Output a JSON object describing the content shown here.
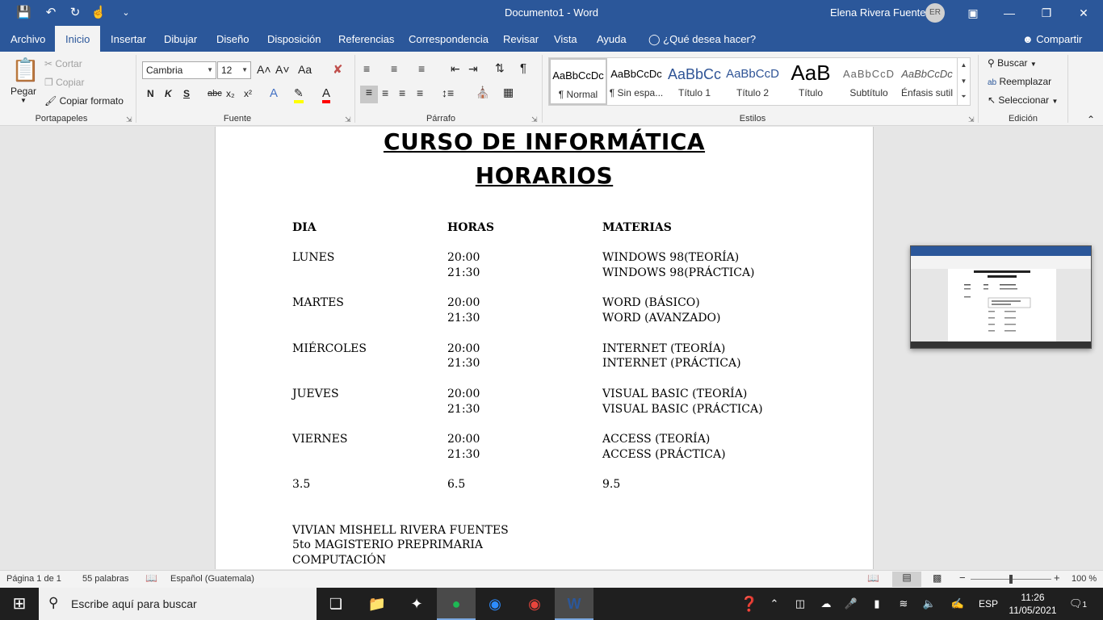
{
  "window": {
    "doc_title": "Documento1  -  Word",
    "user_name": "Elena Rivera Fuentes",
    "user_initials": "ER"
  },
  "qa": {
    "save": "💾",
    "undo": "↶",
    "redo": "↻",
    "touch": "☝",
    "customize": "⌄"
  },
  "tabs": [
    "Archivo",
    "Inicio",
    "Insertar",
    "Dibujar",
    "Diseño",
    "Disposición",
    "Referencias",
    "Correspondencia",
    "Revisar",
    "Vista",
    "Ayuda"
  ],
  "tell_me": "¿Qué desea hacer?",
  "share": "Compartir",
  "clipboard": {
    "paste": "Pegar",
    "cut": "Cortar",
    "copy": "Copiar",
    "format_painter": "Copiar formato",
    "group": "Portapapeles"
  },
  "font": {
    "name": "Cambria",
    "size": "12",
    "group": "Fuente",
    "bold": "N",
    "italic": "K",
    "underline": "S",
    "strike": "abc",
    "sub": "x₂",
    "sup": "x²",
    "grow": "A˄",
    "shrink": "A˅",
    "case": "Aa",
    "effects": "A",
    "color_letter": "A"
  },
  "paragraph": {
    "group": "Párrafo",
    "pilcrow": "¶"
  },
  "styles": {
    "group": "Estilos",
    "items": [
      {
        "preview": "AaBbCcDc",
        "name": "¶ Normal"
      },
      {
        "preview": "AaBbCcDc",
        "name": "¶ Sin espa..."
      },
      {
        "preview": "AaBbCc",
        "name": "Título 1"
      },
      {
        "preview": "AaBbCcD",
        "name": "Título 2"
      },
      {
        "preview": "AaB",
        "name": "Título"
      },
      {
        "preview": "AaBbCcD",
        "name": "Subtítulo"
      },
      {
        "preview": "AaBbCcDc",
        "name": "Énfasis sutil"
      }
    ]
  },
  "editing": {
    "find": "Buscar",
    "replace": "Reemplazar",
    "select": "Seleccionar",
    "group": "Edición"
  },
  "document": {
    "title1": "CURSO DE INFORMÁTICA",
    "title2": "HORARIOS",
    "headers": [
      "DIA",
      "HORAS",
      "MATERIAS"
    ],
    "rows": [
      {
        "day": "LUNES",
        "times": [
          "20:00",
          "21:30"
        ],
        "subjects": [
          "WINDOWS 98(TEORÍA)",
          "WINDOWS 98(PRÁCTICA)"
        ]
      },
      {
        "day": "MARTES",
        "times": [
          "20:00",
          "21:30"
        ],
        "subjects": [
          "WORD (BÁSICO)",
          "WORD (AVANZADO)"
        ]
      },
      {
        "day": "MIÉRCOLES",
        "times": [
          "20:00",
          "21:30"
        ],
        "subjects": [
          "INTERNET (TEORÍA)",
          "INTERNET (PRÁCTICA)"
        ]
      },
      {
        "day": "JUEVES",
        "times": [
          "20:00",
          "21:30"
        ],
        "subjects": [
          "VISUAL BASIC (TEORÍA)",
          "VISUAL BASIC (PRÁCTICA)"
        ]
      },
      {
        "day": "VIERNES",
        "times": [
          "20:00",
          "21:30"
        ],
        "subjects": [
          "ACCESS (TEORÍA)",
          "ACCESS (PRÁCTICA)"
        ]
      }
    ],
    "totals": [
      "3.5",
      "6.5",
      "9.5"
    ],
    "footer": [
      "VIVIAN MISHELL RIVERA FUENTES",
      "5to MAGISTERIO PREPRIMARIA",
      "COMPUTACIÓN"
    ]
  },
  "status": {
    "page": "Página 1 de 1",
    "words": "55 palabras",
    "language": "Español (Guatemala)",
    "zoom": "100 %",
    "zoom_value": 100
  },
  "taskbar": {
    "search_placeholder": "Escribe aquí para buscar",
    "lang": "ESP",
    "time": "11:26",
    "date": "11/05/2021",
    "notifications": "1"
  }
}
